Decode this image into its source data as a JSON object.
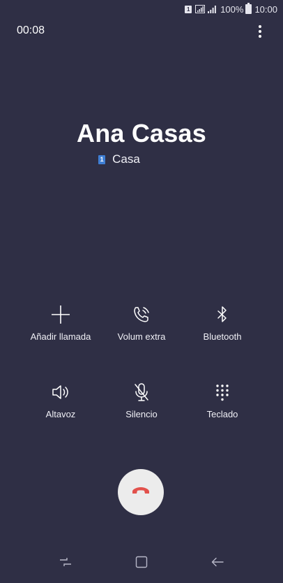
{
  "status_bar": {
    "sim_label": "1",
    "battery_percent": "100%",
    "time": "10:00"
  },
  "call": {
    "timer": "00:08",
    "contact_name": "Ana Casas",
    "sim_slot": "1",
    "number_label": "Casa"
  },
  "actions": [
    {
      "label": "Añadir llamada",
      "icon": "add-call-icon"
    },
    {
      "label": "Volum extra",
      "icon": "extra-volume-icon"
    },
    {
      "label": "Bluetooth",
      "icon": "bluetooth-icon"
    },
    {
      "label": "Altavoz",
      "icon": "speaker-icon"
    },
    {
      "label": "Silencio",
      "icon": "mute-icon"
    },
    {
      "label": "Teclado",
      "icon": "keypad-icon"
    }
  ],
  "colors": {
    "background": "#2f2f45",
    "end_call_bg": "#ececec",
    "end_call_icon": "#e2514c",
    "sim_badge": "#3f7fd4"
  }
}
